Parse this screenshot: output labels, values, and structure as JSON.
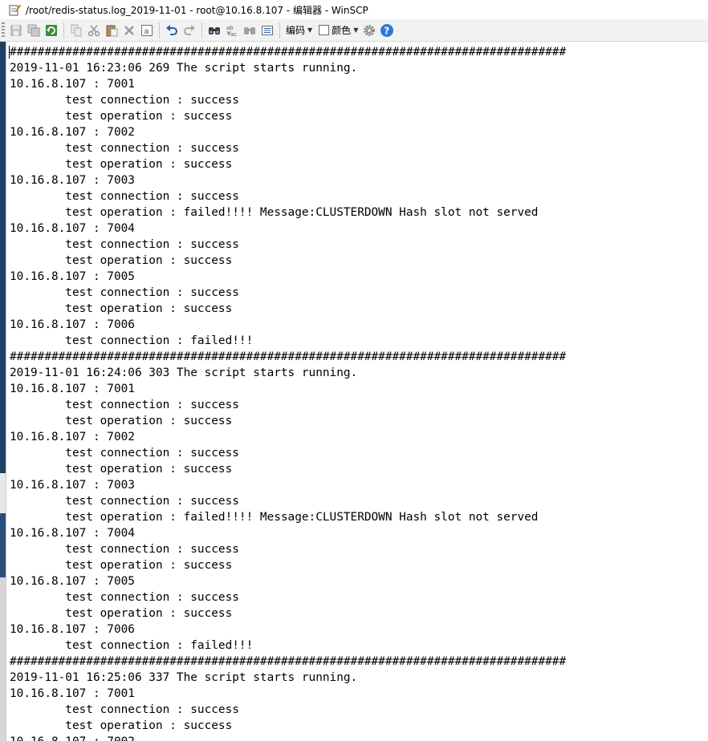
{
  "window": {
    "title": "/root/redis-status.log_2019-11-01 - root@10.16.8.107 - 编辑器 - WinSCP"
  },
  "toolbar": {
    "buttons": [
      {
        "name": "save-icon"
      },
      {
        "name": "save-all-icon"
      },
      {
        "name": "reload-icon"
      },
      {
        "name": "copy-icon"
      },
      {
        "name": "cut-icon"
      },
      {
        "name": "paste-icon"
      },
      {
        "name": "delete-icon"
      },
      {
        "name": "select-all-icon"
      },
      {
        "name": "undo-icon"
      },
      {
        "name": "redo-icon"
      },
      {
        "name": "find-icon"
      },
      {
        "name": "replace-icon"
      },
      {
        "name": "find-next-icon"
      },
      {
        "name": "goto-line-icon"
      }
    ],
    "encoding_label": "编码",
    "color_label": "颜色",
    "settings_icon": "gear-icon",
    "help_icon": "help-icon"
  },
  "editor": {
    "text": "################################################################################\n2019-11-01 16:23:06 269 The script starts running.\n10.16.8.107 : 7001\n        test connection : success\n        test operation : success\n10.16.8.107 : 7002\n        test connection : success\n        test operation : success\n10.16.8.107 : 7003\n        test connection : success\n        test operation : failed!!!! Message:CLUSTERDOWN Hash slot not served\n10.16.8.107 : 7004\n        test connection : success\n        test operation : success\n10.16.8.107 : 7005\n        test connection : success\n        test operation : success\n10.16.8.107 : 7006\n        test connection : failed!!!\n################################################################################\n2019-11-01 16:24:06 303 The script starts running.\n10.16.8.107 : 7001\n        test connection : success\n        test operation : success\n10.16.8.107 : 7002\n        test connection : success\n        test operation : success\n10.16.8.107 : 7003\n        test connection : success\n        test operation : failed!!!! Message:CLUSTERDOWN Hash slot not served\n10.16.8.107 : 7004\n        test connection : success\n        test operation : success\n10.16.8.107 : 7005\n        test connection : success\n        test operation : success\n10.16.8.107 : 7006\n        test connection : failed!!!\n################################################################################\n2019-11-01 16:25:06 337 The script starts running.\n10.16.8.107 : 7001\n        test connection : success\n        test operation : success\n10.16.8.107 : 7002"
  }
}
